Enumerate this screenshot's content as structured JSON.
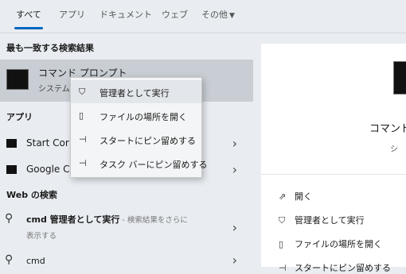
{
  "tabs": [
    "すべて",
    "アプリ",
    "ドキュメント",
    "ウェブ",
    "その他"
  ],
  "sections": {
    "best": "最も一致する検索結果",
    "apps": "アプリ",
    "web": "Web の検索"
  },
  "best_match": {
    "title": "コマンド プロンプト",
    "subtitle": "システム"
  },
  "apps": [
    "Start Cor",
    "Google C"
  ],
  "web": {
    "item1_bold": "cmd 管理者として実行",
    "item1_gray": " - 検索結果をさらに",
    "item1_line2": "表示する",
    "item2": "cmd"
  },
  "context_menu": [
    {
      "label": "管理者として実行",
      "icon": "shield-icon"
    },
    {
      "label": "ファイルの場所を開く",
      "icon": "folder-icon"
    },
    {
      "label": "スタートにピン留めする",
      "icon": "pin-icon"
    },
    {
      "label": "タスク バーにピン留めする",
      "icon": "pin-icon"
    }
  ],
  "right": {
    "title": "コマンド",
    "subtitle": "シ",
    "actions": [
      "開く",
      "管理者として実行",
      "ファイルの場所を開く",
      "スタートにピン留めする"
    ]
  }
}
